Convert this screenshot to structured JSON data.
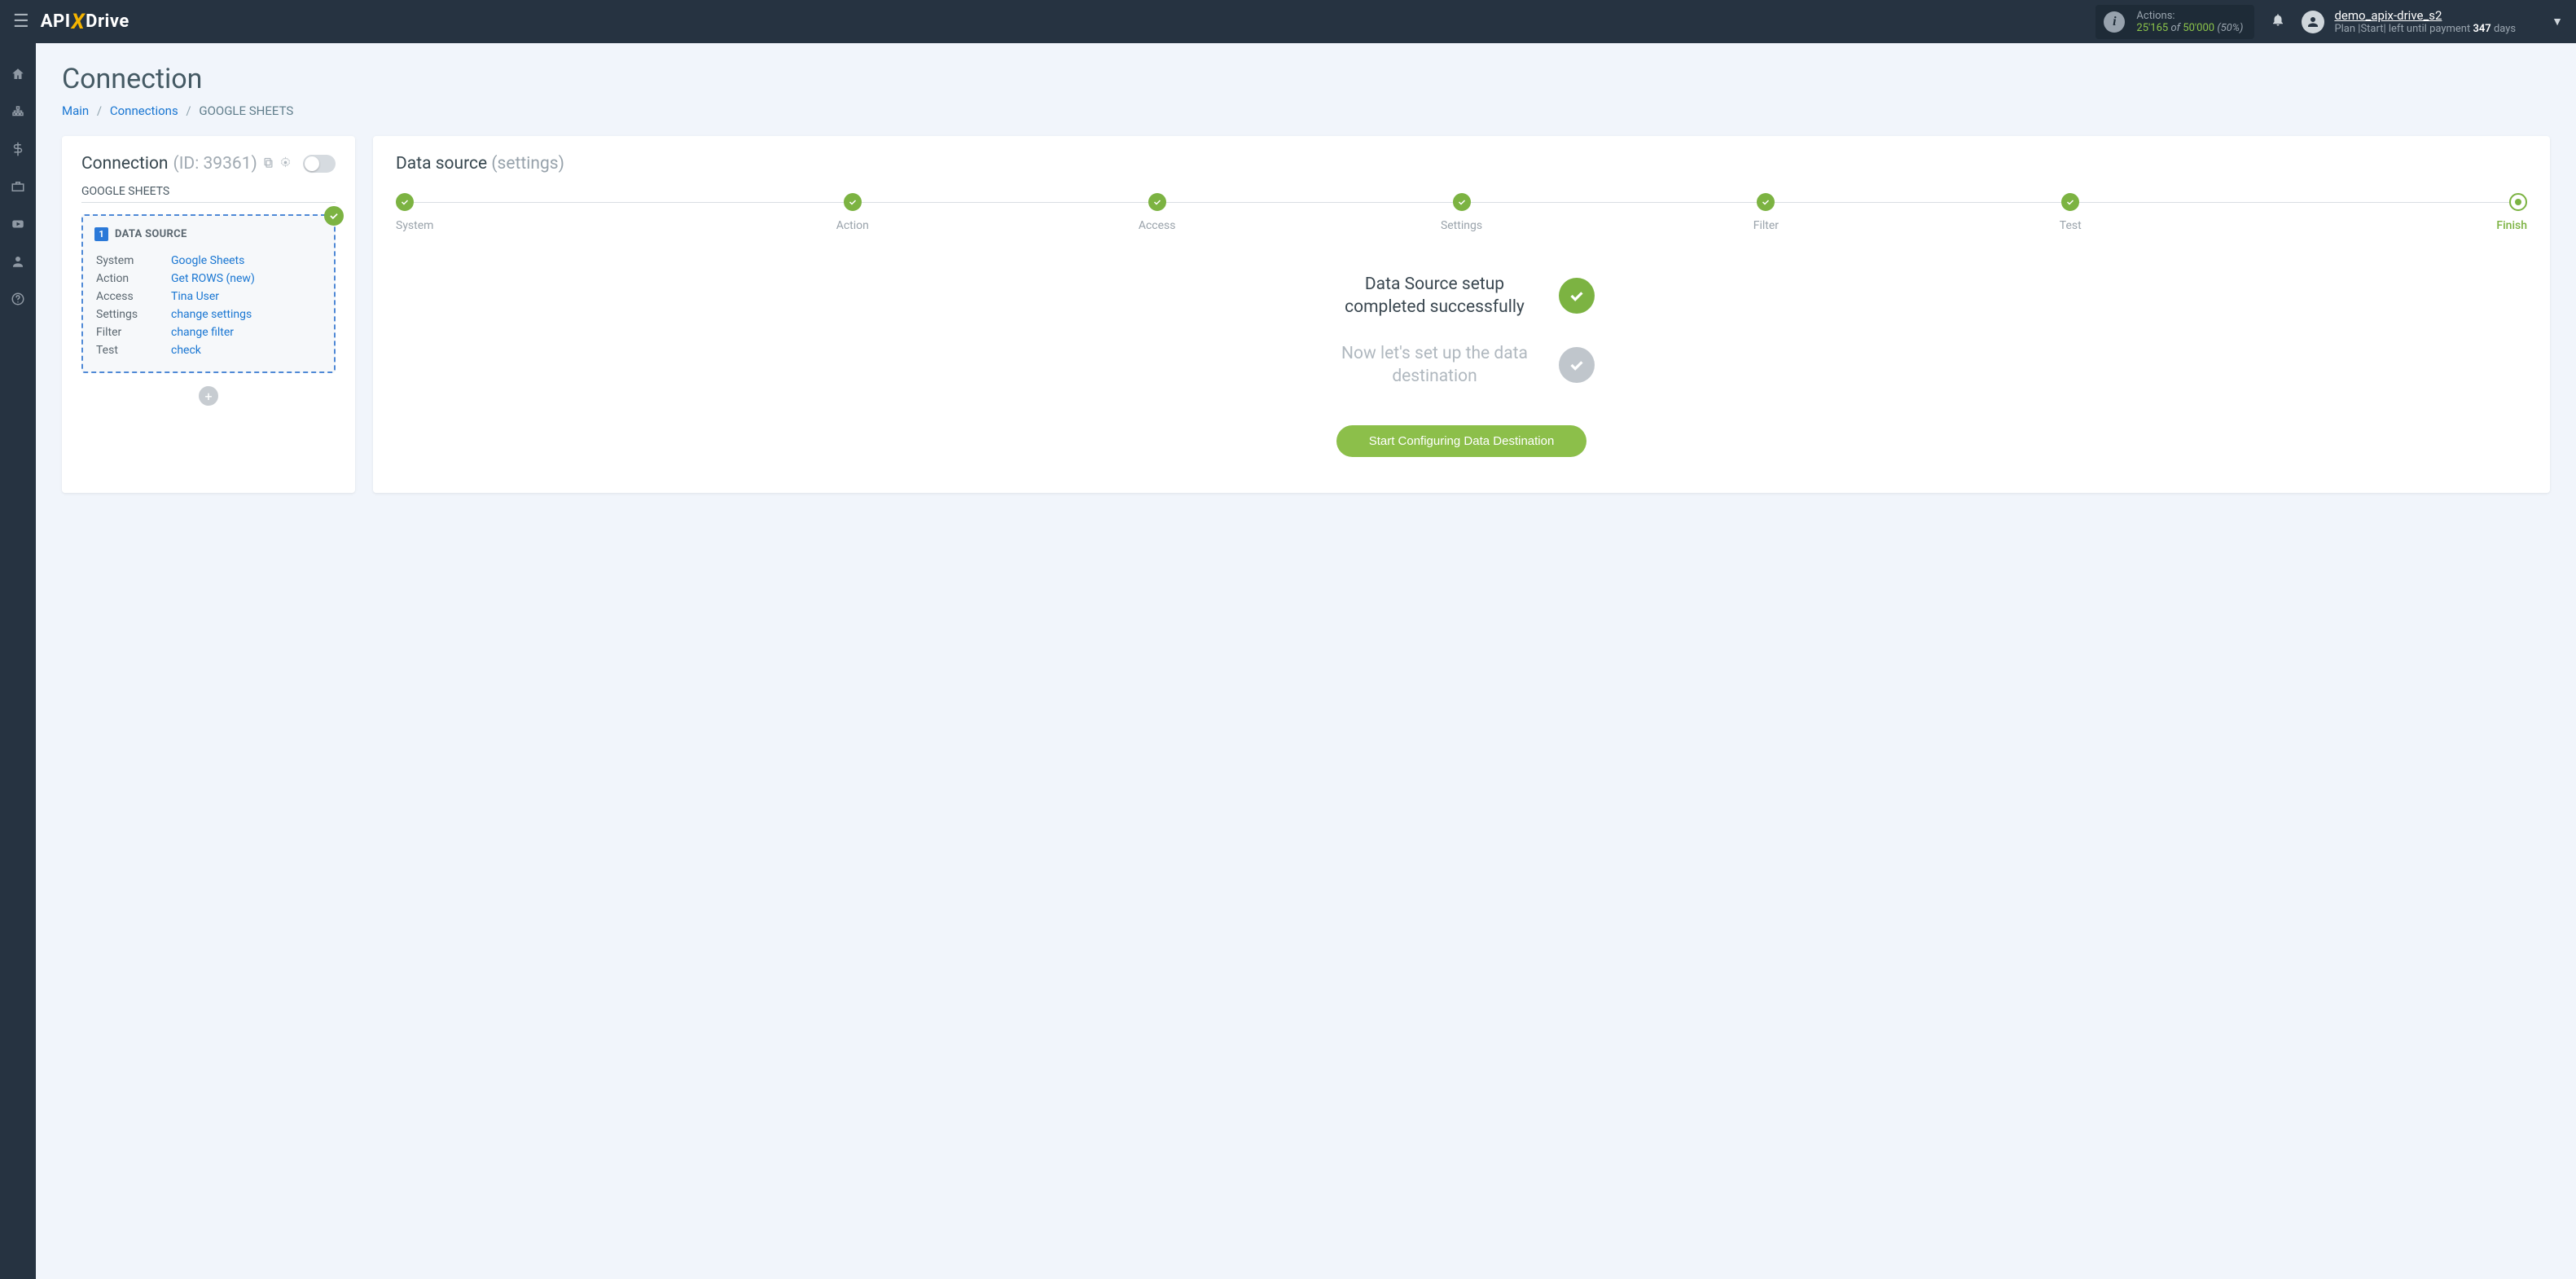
{
  "header": {
    "logo": {
      "api": "API",
      "x": "X",
      "drive": "Drive"
    },
    "actions": {
      "label": "Actions:",
      "used": "25'165",
      "of": "of",
      "total": "50'000",
      "pct": "(50%)"
    },
    "user": {
      "name": "demo_apix-drive_s2",
      "plan_pre": "Plan |Start| left until payment ",
      "days": "347",
      "plan_post": " days"
    }
  },
  "page": {
    "title": "Connection",
    "breadcrumb": {
      "main": "Main",
      "connections": "Connections",
      "current": "GOOGLE SHEETS"
    }
  },
  "left": {
    "conn_label": "Connection ",
    "conn_id": "(ID: 39361)",
    "conn_name": "GOOGLE SHEETS",
    "ds_title": "DATA SOURCE",
    "rows": [
      {
        "k": "System",
        "v": "Google Sheets"
      },
      {
        "k": "Action",
        "v": "Get ROWS (new)"
      },
      {
        "k": "Access",
        "v": "Tina User"
      },
      {
        "k": "Settings",
        "v": "change settings"
      },
      {
        "k": "Filter",
        "v": "change filter"
      },
      {
        "k": "Test",
        "v": "check"
      }
    ]
  },
  "right": {
    "title": "Data source ",
    "subtitle": "(settings)",
    "steps": [
      {
        "label": "System",
        "state": "done"
      },
      {
        "label": "Action",
        "state": "done"
      },
      {
        "label": "Access",
        "state": "done"
      },
      {
        "label": "Settings",
        "state": "done"
      },
      {
        "label": "Filter",
        "state": "done"
      },
      {
        "label": "Test",
        "state": "done"
      },
      {
        "label": "Finish",
        "state": "current"
      }
    ],
    "msg1": "Data Source setup completed successfully",
    "msg2": "Now let's set up the data destination",
    "cta": "Start Configuring Data Destination"
  }
}
